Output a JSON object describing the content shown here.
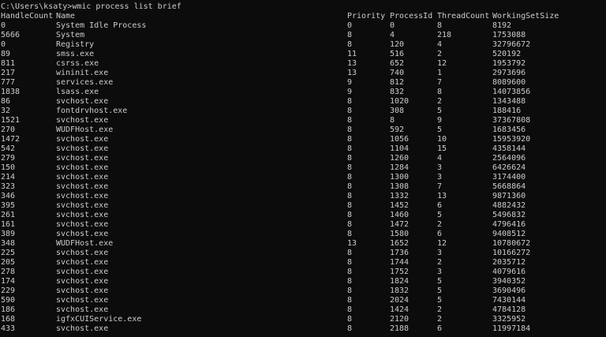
{
  "prompt": {
    "path": "C:\\Users\\ksaty>",
    "command": "wmic process list brief"
  },
  "table": {
    "columns": [
      "HandleCount",
      "Name",
      "Priority",
      "ProcessId",
      "ThreadCount",
      "WorkingSetSize"
    ],
    "rows": [
      [
        "0",
        "System Idle Process",
        "0",
        "0",
        "8",
        "8192"
      ],
      [
        "5666",
        "System",
        "8",
        "4",
        "218",
        "1753088"
      ],
      [
        "0",
        "Registry",
        "8",
        "120",
        "4",
        "32796672"
      ],
      [
        "89",
        "smss.exe",
        "11",
        "516",
        "2",
        "520192"
      ],
      [
        "811",
        "csrss.exe",
        "13",
        "652",
        "12",
        "1953792"
      ],
      [
        "217",
        "wininit.exe",
        "13",
        "740",
        "1",
        "2973696"
      ],
      [
        "777",
        "services.exe",
        "9",
        "812",
        "7",
        "8089600"
      ],
      [
        "1838",
        "lsass.exe",
        "9",
        "832",
        "8",
        "14073856"
      ],
      [
        "86",
        "svchost.exe",
        "8",
        "1020",
        "2",
        "1343488"
      ],
      [
        "32",
        "fontdrvhost.exe",
        "8",
        "308",
        "5",
        "188416"
      ],
      [
        "1521",
        "svchost.exe",
        "8",
        "8",
        "9",
        "37367808"
      ],
      [
        "270",
        "WUDFHost.exe",
        "8",
        "592",
        "5",
        "1683456"
      ],
      [
        "1472",
        "svchost.exe",
        "8",
        "1056",
        "10",
        "15953920"
      ],
      [
        "542",
        "svchost.exe",
        "8",
        "1104",
        "15",
        "4358144"
      ],
      [
        "279",
        "svchost.exe",
        "8",
        "1260",
        "4",
        "2564096"
      ],
      [
        "150",
        "svchost.exe",
        "8",
        "1284",
        "3",
        "6426624"
      ],
      [
        "214",
        "svchost.exe",
        "8",
        "1300",
        "3",
        "3174400"
      ],
      [
        "323",
        "svchost.exe",
        "8",
        "1308",
        "7",
        "5668864"
      ],
      [
        "346",
        "svchost.exe",
        "8",
        "1332",
        "13",
        "9871360"
      ],
      [
        "395",
        "svchost.exe",
        "8",
        "1452",
        "6",
        "4882432"
      ],
      [
        "261",
        "svchost.exe",
        "8",
        "1460",
        "5",
        "5496832"
      ],
      [
        "161",
        "svchost.exe",
        "8",
        "1472",
        "2",
        "4796416"
      ],
      [
        "389",
        "svchost.exe",
        "8",
        "1580",
        "6",
        "9408512"
      ],
      [
        "348",
        "WUDFHost.exe",
        "13",
        "1652",
        "12",
        "10780672"
      ],
      [
        "225",
        "svchost.exe",
        "8",
        "1736",
        "3",
        "10166272"
      ],
      [
        "205",
        "svchost.exe",
        "8",
        "1744",
        "2",
        "2035712"
      ],
      [
        "278",
        "svchost.exe",
        "8",
        "1752",
        "3",
        "4079616"
      ],
      [
        "174",
        "svchost.exe",
        "8",
        "1824",
        "5",
        "3940352"
      ],
      [
        "229",
        "svchost.exe",
        "8",
        "1832",
        "5",
        "3690496"
      ],
      [
        "590",
        "svchost.exe",
        "8",
        "2024",
        "5",
        "7430144"
      ],
      [
        "186",
        "svchost.exe",
        "8",
        "1424",
        "2",
        "4784128"
      ],
      [
        "168",
        "igfxCUIService.exe",
        "8",
        "2120",
        "2",
        "3325952"
      ],
      [
        "433",
        "svchost.exe",
        "8",
        "2188",
        "6",
        "11997184"
      ]
    ]
  },
  "colors": {
    "background": "#0c0c0c",
    "text": "#cccccc"
  }
}
